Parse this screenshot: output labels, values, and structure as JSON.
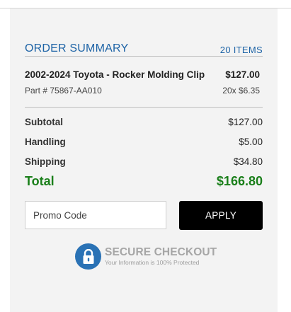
{
  "summary": {
    "title": "ORDER SUMMARY",
    "item_count": "20 ITEMS"
  },
  "item": {
    "name": "2002-2024 Toyota - Rocker Molding Clip",
    "price": "$127.00",
    "part": "Part # 75867-AA010",
    "qty": "20x $6.35"
  },
  "totals": {
    "subtotal_label": "Subtotal",
    "subtotal_value": "$127.00",
    "handling_label": "Handling",
    "handling_value": "$5.00",
    "shipping_label": "Shipping",
    "shipping_value": "$34.80",
    "total_label": "Total",
    "total_value": "$166.80"
  },
  "promo": {
    "placeholder": "Promo Code",
    "apply_label": "APPLY"
  },
  "secure": {
    "title": "SECURE CHECKOUT",
    "subtitle": "Your Information is 100% Protected",
    "icon": "lock-icon"
  },
  "colors": {
    "accent_blue": "#1d63a6",
    "total_green": "#1a7f1a",
    "panel_bg": "#f3f3f3",
    "button_black": "#000000"
  }
}
